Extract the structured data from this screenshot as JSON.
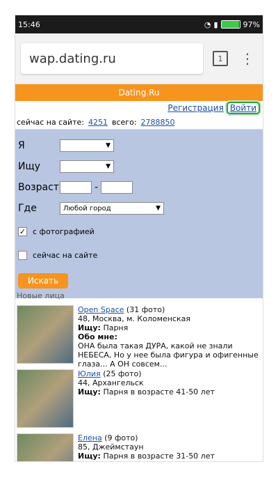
{
  "status": {
    "time": "15:46",
    "battery_percent": "97%",
    "battery_level": 0.97
  },
  "browser": {
    "url": "wap.dating.ru",
    "tab_count": "1",
    "menu_icon": "⋮"
  },
  "site": {
    "banner": "Dating.Ru",
    "register_link": "Регистрация",
    "login_link": "Войти"
  },
  "stats": {
    "online_label": "сейчас на сайте:",
    "online_count": "4251",
    "total_label": "всего:",
    "total_count": "2788850"
  },
  "form": {
    "iam_label": "Я",
    "seek_label": "Ищу",
    "age_label": "Возраст",
    "where_label": "Где",
    "city_value": "Любой город",
    "with_photo_label": "с фотографией",
    "with_photo_checked": true,
    "online_now_label": "сейчас на сайте",
    "online_now_checked": false,
    "search_button": "Искать"
  },
  "new_faces_title": "Новые лица",
  "profiles": [
    {
      "name": "Open Space",
      "photos": "(31 фото)",
      "line1": "48, Москва, м. Коломенская",
      "seek_label": "Ищу:",
      "seek": "Парня",
      "about_label": "Обо мне:",
      "about": "ОНА была такая ДУРА, какой не знали НЕБЕСА, Но у нее была фигура и офигенные глаза... А ОН совсем..."
    },
    {
      "name": "Юлия",
      "photos": "(25 фото)",
      "line1": "44, Архангельск",
      "seek_label": "Ищу:",
      "seek": "Парня в возрасте 41-50 лет"
    },
    {
      "name": "Елена",
      "photos": "(9 фото)",
      "line1": "85, Джеймстаун",
      "seek_label": "Ищу:",
      "seek": "Парня в возрасте 31-50 лет"
    }
  ]
}
